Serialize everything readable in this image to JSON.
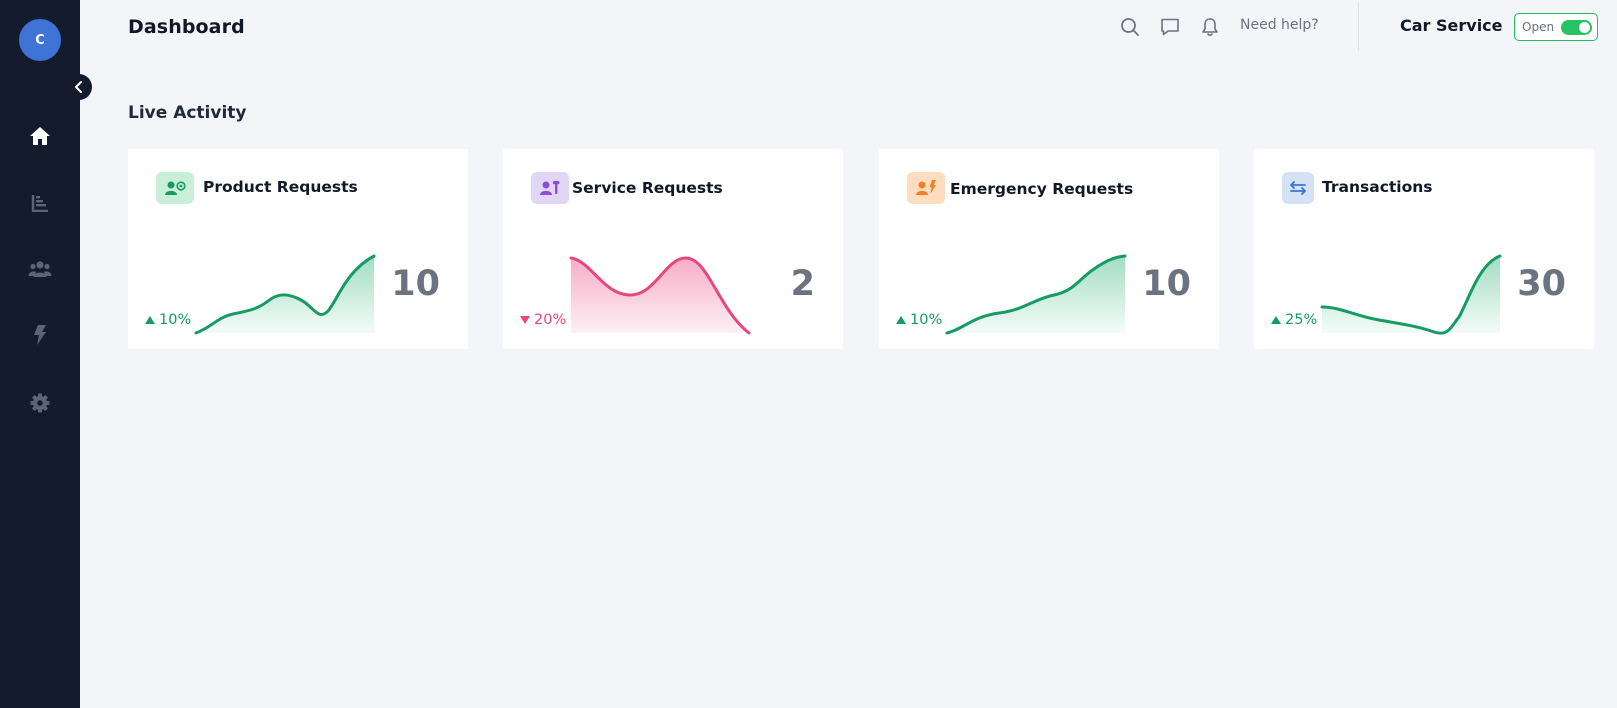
{
  "sidebar": {
    "avatar_initial": "C",
    "items": [
      {
        "name": "home",
        "icon": "home-icon",
        "active": true
      },
      {
        "name": "reports",
        "icon": "bar-chart-icon"
      },
      {
        "name": "customers",
        "icon": "users-icon"
      },
      {
        "name": "emergency",
        "icon": "lightning-icon"
      },
      {
        "name": "settings",
        "icon": "gear-icon"
      }
    ]
  },
  "header": {
    "title": "Dashboard",
    "help_label": "Need help?",
    "store_name": "Car Service",
    "status_label": "Open",
    "status_on": true
  },
  "live_activity": {
    "title": "Live Activity",
    "cards": [
      {
        "title": "Product Requests",
        "value": "10",
        "trend": "10%",
        "trend_direction": "up",
        "icon": "user-target-icon",
        "accent": "#169c62",
        "icon_bg": "#c9efd9"
      },
      {
        "title": "Service Requests",
        "value": "2",
        "trend": "20%",
        "trend_direction": "down",
        "icon": "user-tool-icon",
        "accent": "#e8467c",
        "icon_bg": "#e2d6f7"
      },
      {
        "title": "Emergency Requests",
        "value": "10",
        "trend": "10%",
        "trend_direction": "up",
        "icon": "user-lightning-icon",
        "accent": "#169c62",
        "icon_bg": "#fddcbf"
      },
      {
        "title": "Transactions",
        "value": "30",
        "trend": "25%",
        "trend_direction": "up",
        "icon": "transfer-arrows-icon",
        "accent": "#169c62",
        "icon_bg": "#d5e2f6"
      }
    ]
  },
  "colors": {
    "sidebar_bg": "#141b2d",
    "positive": "#169c62",
    "negative": "#e8467c",
    "avatar_bg": "#3f74d6",
    "toggle_on": "#27c263"
  }
}
